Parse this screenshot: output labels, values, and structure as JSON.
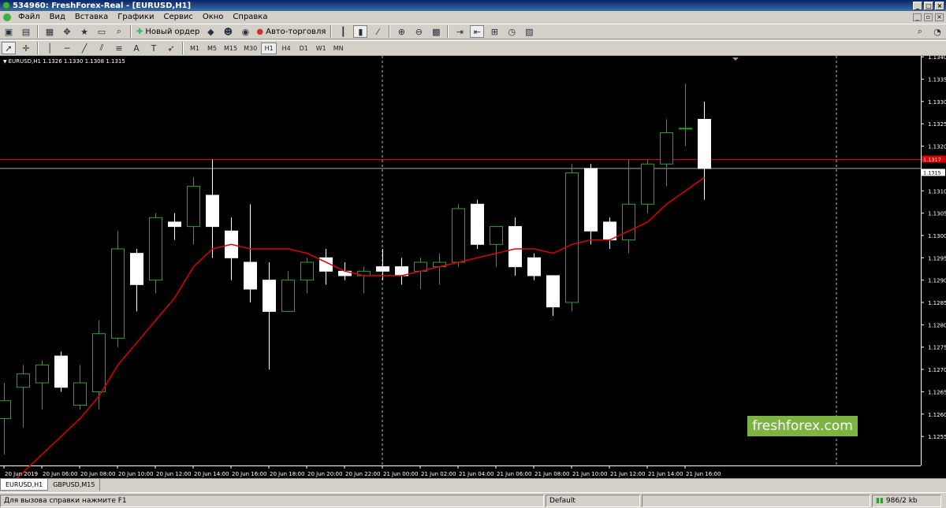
{
  "window": {
    "title": "534960: FreshForex-Real - [EURUSD,H1]"
  },
  "menu": [
    "Файл",
    "Вид",
    "Вставка",
    "Графики",
    "Сервис",
    "Окно",
    "Справка"
  ],
  "toolbar": {
    "new_order": "Новый ордер",
    "auto_trading": "Авто-торговля"
  },
  "timeframes": [
    "M1",
    "M5",
    "M15",
    "M30",
    "H1",
    "H4",
    "D1",
    "W1",
    "MN"
  ],
  "active_timeframe": "H1",
  "chart_header": "EURUSD,H1  1.1326 1.1330 1.1308 1.1315",
  "brand": "freshforex.com",
  "tabs": [
    "EURUSD,H1",
    "GBPUSD,M15"
  ],
  "status": {
    "help": "Для вызова справки нажмите F1",
    "profile": "Default",
    "traffic": "986/2 kb"
  },
  "colors": {
    "bull": "#22aa22",
    "bear": "#ffffff",
    "ma": "#dd0000",
    "bid_line": "#dd0000",
    "ask_line": "#aaaaaa",
    "background": "#000000"
  },
  "chart_data": {
    "type": "candlestick",
    "symbol": "EURUSD",
    "timeframe": "H1",
    "price_labels": [
      "1.1340",
      "1.1335",
      "1.1330",
      "1.1325",
      "1.1320",
      "1.1317",
      "1.1315",
      "1.1310",
      "1.1305",
      "1.1300",
      "1.1295",
      "1.1290",
      "1.1285",
      "1.1280",
      "1.1275",
      "1.1270",
      "1.1265",
      "1.1260",
      "1.1255"
    ],
    "y_ticks": [
      1.134,
      1.1335,
      1.133,
      1.1325,
      1.132,
      1.131,
      1.1305,
      1.13,
      1.1295,
      1.129,
      1.1285,
      1.128,
      1.1275,
      1.127,
      1.1265,
      1.126,
      1.1255
    ],
    "ylim": [
      1.12485,
      1.13402
    ],
    "time_labels": [
      "20 Jun 2019",
      "20 Jun 06:00",
      "20 Jun 08:00",
      "20 Jun 10:00",
      "20 Jun 12:00",
      "20 Jun 14:00",
      "20 Jun 16:00",
      "20 Jun 18:00",
      "20 Jun 20:00",
      "20 Jun 22:00",
      "21 Jun 00:00",
      "21 Jun 02:00",
      "21 Jun 04:00",
      "21 Jun 06:00",
      "21 Jun 08:00",
      "21 Jun 10:00",
      "21 Jun 12:00",
      "21 Jun 14:00",
      "21 Jun 16:00"
    ],
    "bid_price": 1.1317,
    "ask_price": 1.1315,
    "candles": [
      {
        "o": 1.1259,
        "h": 1.1267,
        "l": 1.1251,
        "c": 1.1263
      },
      {
        "o": 1.1266,
        "h": 1.1271,
        "l": 1.1257,
        "c": 1.1269
      },
      {
        "o": 1.1267,
        "h": 1.1272,
        "l": 1.1261,
        "c": 1.1271
      },
      {
        "o": 1.1273,
        "h": 1.1274,
        "l": 1.1265,
        "c": 1.1266
      },
      {
        "o": 1.1262,
        "h": 1.1271,
        "l": 1.1261,
        "c": 1.1267
      },
      {
        "o": 1.1265,
        "h": 1.1281,
        "l": 1.1261,
        "c": 1.1278
      },
      {
        "o": 1.1277,
        "h": 1.1301,
        "l": 1.1275,
        "c": 1.1297
      },
      {
        "o": 1.1296,
        "h": 1.1297,
        "l": 1.1283,
        "c": 1.1289
      },
      {
        "o": 1.129,
        "h": 1.1305,
        "l": 1.1287,
        "c": 1.1304
      },
      {
        "o": 1.1303,
        "h": 1.1305,
        "l": 1.1299,
        "c": 1.1302
      },
      {
        "o": 1.1302,
        "h": 1.1313,
        "l": 1.1298,
        "c": 1.1311
      },
      {
        "o": 1.1309,
        "h": 1.1317,
        "l": 1.1295,
        "c": 1.1302
      },
      {
        "o": 1.1301,
        "h": 1.1304,
        "l": 1.129,
        "c": 1.1295
      },
      {
        "o": 1.1294,
        "h": 1.1307,
        "l": 1.1285,
        "c": 1.1288
      },
      {
        "o": 1.129,
        "h": 1.1294,
        "l": 1.127,
        "c": 1.1283
      },
      {
        "o": 1.1283,
        "h": 1.1292,
        "l": 1.1283,
        "c": 1.129
      },
      {
        "o": 1.129,
        "h": 1.1295,
        "l": 1.1287,
        "c": 1.1294
      },
      {
        "o": 1.1295,
        "h": 1.1297,
        "l": 1.1289,
        "c": 1.1292
      },
      {
        "o": 1.1292,
        "h": 1.1294,
        "l": 1.129,
        "c": 1.1291
      },
      {
        "o": 1.1291,
        "h": 1.1293,
        "l": 1.1287,
        "c": 1.1292
      },
      {
        "o": 1.1293,
        "h": 1.1297,
        "l": 1.129,
        "c": 1.1292
      },
      {
        "o": 1.1293,
        "h": 1.1295,
        "l": 1.1289,
        "c": 1.1291
      },
      {
        "o": 1.1292,
        "h": 1.1295,
        "l": 1.1288,
        "c": 1.1294
      },
      {
        "o": 1.1293,
        "h": 1.1296,
        "l": 1.1289,
        "c": 1.1294
      },
      {
        "o": 1.1294,
        "h": 1.1307,
        "l": 1.1293,
        "c": 1.1306
      },
      {
        "o": 1.1307,
        "h": 1.1308,
        "l": 1.1297,
        "c": 1.1298
      },
      {
        "o": 1.1298,
        "h": 1.1302,
        "l": 1.1293,
        "c": 1.1302
      },
      {
        "o": 1.1302,
        "h": 1.1304,
        "l": 1.1291,
        "c": 1.1293
      },
      {
        "o": 1.1295,
        "h": 1.1296,
        "l": 1.129,
        "c": 1.1291
      },
      {
        "o": 1.1291,
        "h": 1.1291,
        "l": 1.1282,
        "c": 1.1284
      },
      {
        "o": 1.1285,
        "h": 1.1316,
        "l": 1.1283,
        "c": 1.1314
      },
      {
        "o": 1.1315,
        "h": 1.1316,
        "l": 1.1298,
        "c": 1.1301
      },
      {
        "o": 1.1303,
        "h": 1.1304,
        "l": 1.1297,
        "c": 1.1299
      },
      {
        "o": 1.1299,
        "h": 1.1317,
        "l": 1.1296,
        "c": 1.1307
      },
      {
        "o": 1.1307,
        "h": 1.1317,
        "l": 1.1305,
        "c": 1.1316
      },
      {
        "o": 1.1316,
        "h": 1.1326,
        "l": 1.1311,
        "c": 1.1323
      },
      {
        "o": 1.1324,
        "h": 1.1334,
        "l": 1.132,
        "c": 1.1324
      },
      {
        "o": 1.1326,
        "h": 1.133,
        "l": 1.1308,
        "c": 1.1315
      }
    ],
    "moving_average": [
      1.1243,
      1.1247,
      1.1251,
      1.1255,
      1.1259,
      1.1264,
      1.1271,
      1.1276,
      1.1281,
      1.1286,
      1.1293,
      1.1297,
      1.1298,
      1.1297,
      1.1297,
      1.1297,
      1.1296,
      1.1294,
      1.1292,
      1.1291,
      1.1291,
      1.1291,
      1.1292,
      1.1293,
      1.1294,
      1.1295,
      1.1296,
      1.1297,
      1.1297,
      1.1296,
      1.1298,
      1.1299,
      1.1299,
      1.1301,
      1.1303,
      1.1307,
      1.131,
      1.1313
    ],
    "period_separators": [
      "21 Jun 00:00",
      "21 Jun 23:00"
    ]
  }
}
